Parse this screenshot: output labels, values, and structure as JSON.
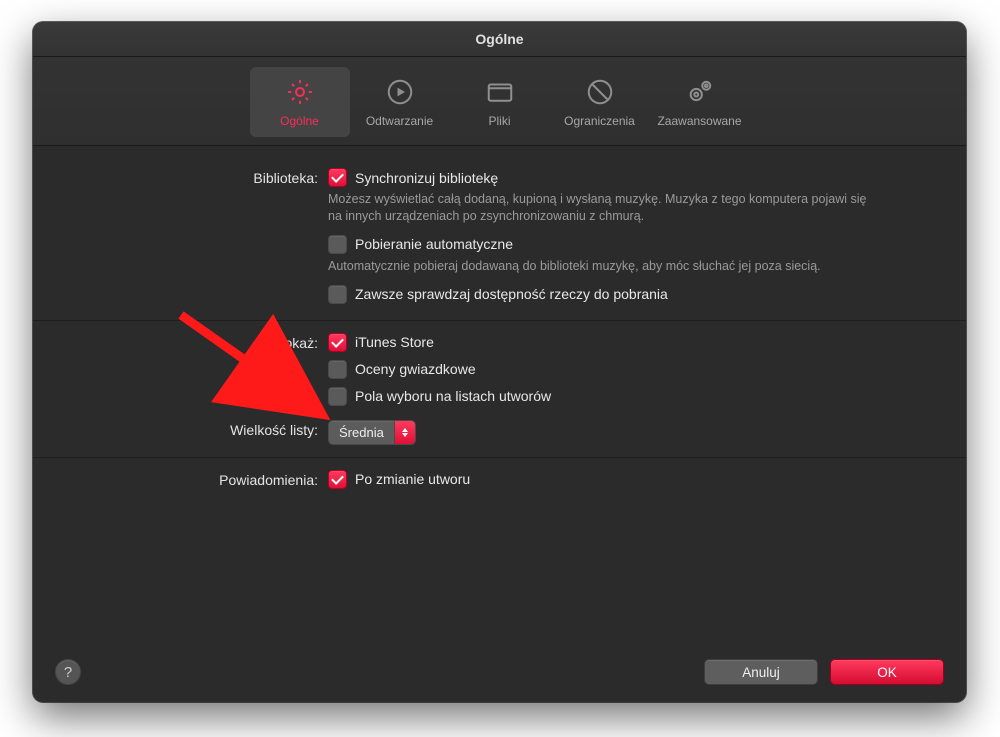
{
  "window": {
    "title": "Ogólne"
  },
  "tabs": {
    "general": {
      "label": "Ogólne"
    },
    "playback": {
      "label": "Odtwarzanie"
    },
    "files": {
      "label": "Pliki"
    },
    "restrictions": {
      "label": "Ograniczenia"
    },
    "advanced": {
      "label": "Zaawansowane"
    }
  },
  "library": {
    "label": "Biblioteka:",
    "sync": {
      "checked": true,
      "label": "Synchronizuj bibliotekę",
      "desc": "Możesz wyświetlać całą dodaną, kupioną i wysłaną muzykę. Muzyka z tego komputera pojawi się na innych urządzeniach po zsynchronizowaniu z chmurą."
    },
    "autodown": {
      "checked": false,
      "label": "Pobieranie automatyczne",
      "desc": "Automatycznie pobieraj dodawaną do biblioteki muzykę, aby móc słuchać jej poza siecią."
    },
    "checkdl": {
      "checked": false,
      "label": "Zawsze sprawdzaj dostępność rzeczy do pobrania"
    }
  },
  "show": {
    "label": "Pokaż:",
    "itunes": {
      "checked": true,
      "label": "iTunes Store"
    },
    "ratings": {
      "checked": false,
      "label": "Oceny gwiazdkowe"
    },
    "listcb": {
      "checked": false,
      "label": "Pola wyboru na listach utworów"
    }
  },
  "listsize": {
    "label": "Wielkość listy:",
    "value": "Średnia"
  },
  "notifications": {
    "label": "Powiadomienia:",
    "onchange": {
      "checked": true,
      "label": "Po zmianie utworu"
    }
  },
  "footer": {
    "help": "?",
    "cancel": "Anuluj",
    "ok": "OK"
  }
}
